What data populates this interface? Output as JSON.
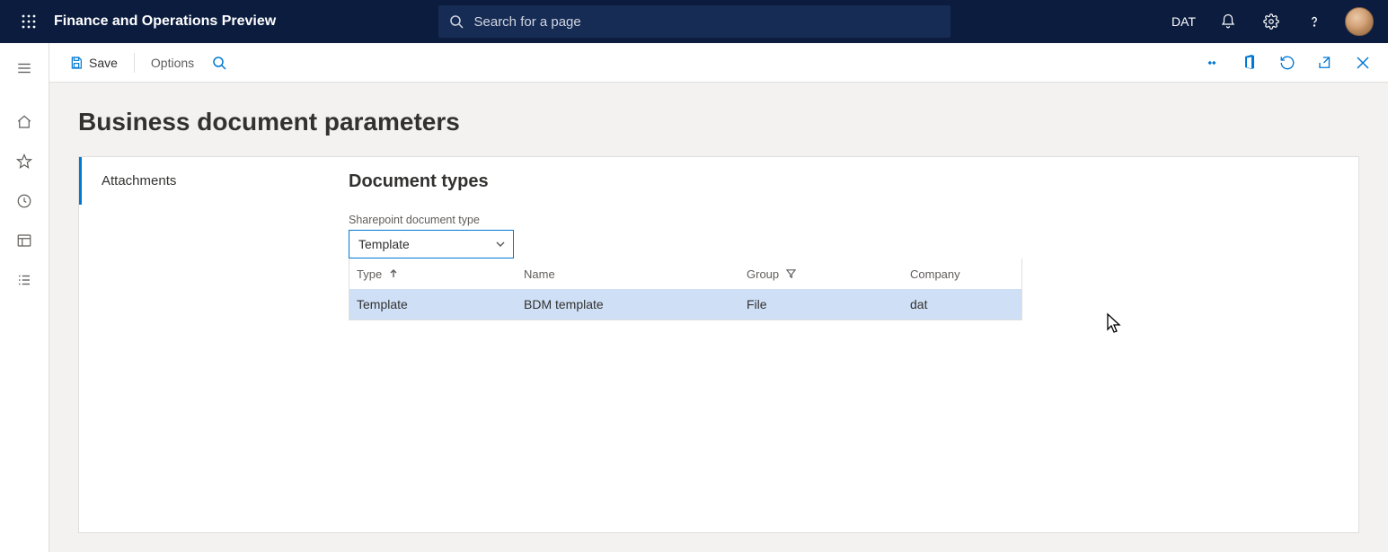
{
  "topbar": {
    "app_title": "Finance and Operations Preview",
    "search_placeholder": "Search for a page",
    "company": "DAT"
  },
  "actionbar": {
    "save_label": "Save",
    "options_label": "Options"
  },
  "page": {
    "title": "Business document parameters"
  },
  "tabs": {
    "items": [
      {
        "label": "Attachments"
      }
    ]
  },
  "panel": {
    "section_title": "Document types",
    "field_label": "Sharepoint document type",
    "dropdown_value": "Template",
    "columns": {
      "type": "Type",
      "name": "Name",
      "group": "Group",
      "company": "Company"
    },
    "rows": [
      {
        "type": "Template",
        "name": "BDM template",
        "group": "File",
        "company": "dat"
      }
    ]
  }
}
